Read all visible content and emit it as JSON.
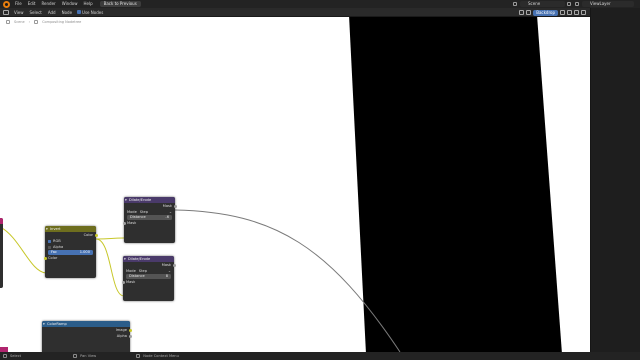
{
  "topbar": {
    "menus": [
      "File",
      "Edit",
      "Render",
      "Window",
      "Help"
    ],
    "back_button": "Back to Previous",
    "scene": "Scene",
    "view_layer": "ViewLayer"
  },
  "header": {
    "menus": [
      "View",
      "Select",
      "Add",
      "Node"
    ],
    "use_nodes_label": "Use Nodes",
    "backdrop_button": "Backdrop"
  },
  "breadcrumb": {
    "scene": "Scene",
    "tree": "Compositing Nodetree"
  },
  "nodes": {
    "invert": {
      "title": "Invert",
      "out_color": "Color",
      "rgb": "RGB",
      "alpha": "Alpha",
      "fac_label": "Fac",
      "fac_value": "1.000",
      "in_color": "Color"
    },
    "dilate1": {
      "title": "Dilate/Erode",
      "out_mask": "Mask",
      "mode_label": "Mode",
      "mode_value": "Step",
      "distance_label": "Distance",
      "distance_value": "-6",
      "in_mask": "Mask"
    },
    "dilate2": {
      "title": "Dilate/Erode",
      "out_mask": "Mask",
      "mode_label": "Mode",
      "mode_value": "Step",
      "distance_label": "Distance",
      "distance_value": "8",
      "in_mask": "Mask"
    },
    "colorramp": {
      "title": "ColorRamp",
      "out_image": "Image",
      "out_alpha": "Alpha"
    }
  },
  "colors": {
    "invert_header": "#6e6e1e",
    "dilate_header": "#4a3a6a",
    "colorramp_header": "#2b5d8a",
    "link": "#7a7a7a",
    "accent": "#4772b3"
  },
  "statusbar": {
    "select": "Select",
    "pan_view": "Pan View",
    "context_menu": "Node Context Menu"
  }
}
